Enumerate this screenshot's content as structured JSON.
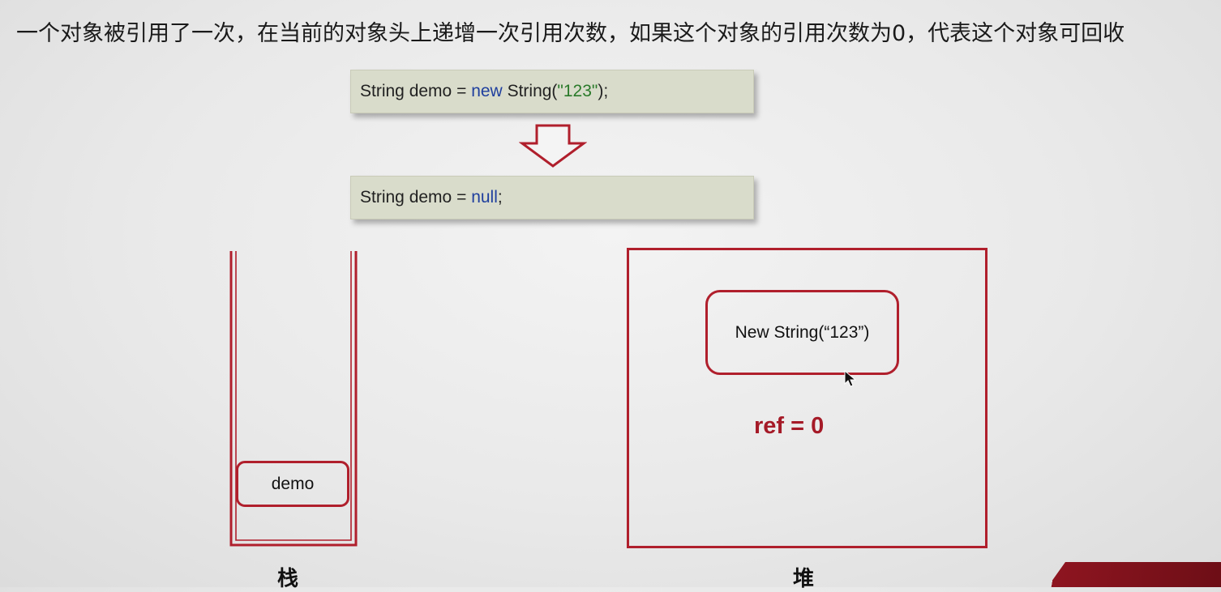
{
  "heading": "一个对象被引用了一次，在当前的对象头上递增一次引用次数，如果这个对象的引用次数为0，代表这个对象可回收",
  "code_before": {
    "type": "String",
    "name": "demo",
    "eq": "=",
    "keyword": "new",
    "ctor": "String(",
    "literal": "\"123\"",
    "end": ");"
  },
  "code_after": {
    "type": "String",
    "name": "demo",
    "eq": "=",
    "keyword": "null",
    "end": ";"
  },
  "stack": {
    "label": "栈",
    "variable": "demo"
  },
  "heap": {
    "label": "堆",
    "object": "New String(“123”)",
    "ref_label": "ref",
    "ref_eq": "=",
    "ref_count": "0"
  },
  "colors": {
    "outline": "#b01f2c",
    "ref_text": "#a51a27",
    "code_bg": "#d9dccb",
    "keyword": "#1f3f9e",
    "string_literal": "#2a7a2a"
  }
}
